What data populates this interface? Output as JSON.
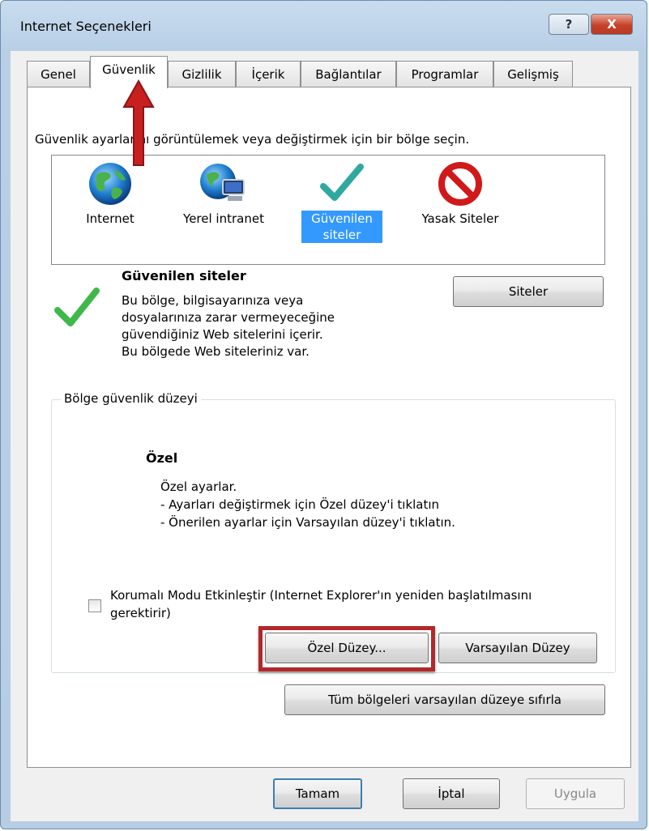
{
  "window": {
    "title": "Internet Seçenekleri",
    "help_label": "?",
    "close_label": "X"
  },
  "tabs": [
    {
      "label": "Genel"
    },
    {
      "label": "Güvenlik"
    },
    {
      "label": "Gizlilik"
    },
    {
      "label": "İçerik"
    },
    {
      "label": "Bağlantılar"
    },
    {
      "label": "Programlar"
    },
    {
      "label": "Gelişmiş"
    }
  ],
  "active_tab": "Güvenlik",
  "security": {
    "instruction": "Güvenlik ayarlarını görüntülemek veya değiştirmek için bir bölge seçin.",
    "zones": [
      {
        "label": "Internet",
        "icon": "globe-icon"
      },
      {
        "label": "Yerel intranet",
        "icon": "intranet-globe-icon"
      },
      {
        "label_line1": "Güvenilen",
        "label_line2": "siteler",
        "icon": "green-check-icon",
        "selected": true
      },
      {
        "label": "Yasak Siteler",
        "icon": "no-entry-icon"
      }
    ],
    "selected_zone": {
      "title": "Güvenilen siteler",
      "description_lines": [
        "Bu bölge, bilgisayarınıza veya",
        "dosyalarınıza zarar vermeyeceğine",
        "güvendiğiniz Web sitelerini içerir.",
        "Bu bölgede Web siteleriniz var."
      ],
      "sites_button": "Siteler"
    },
    "level_group": {
      "legend": "Bölge güvenlik düzeyi",
      "level_title": "Özel",
      "level_lines": [
        "Özel ayarlar.",
        "- Ayarları değiştirmek için Özel düzey'i tıklatın",
        "- Önerilen ayarlar için Varsayılan düzey'i tıklatın."
      ],
      "protected_mode_label": "Korumalı Modu Etkinleştir (Internet Explorer'ın yeniden başlatılmasını gerektirir)",
      "protected_mode_checked": false,
      "custom_level_button": "Özel Düzey...",
      "default_level_button": "Varsayılan Düzey"
    },
    "reset_all_button": "Tüm bölgeleri varsayılan düzeye sıfırla"
  },
  "footer": {
    "ok_button": "Tamam",
    "cancel_button": "İptal",
    "apply_button": "Uygula",
    "apply_enabled": false
  },
  "colors": {
    "selection": "#3399ff",
    "annotation_red": "#b3282a",
    "focus_border": "#3c7fb1"
  }
}
